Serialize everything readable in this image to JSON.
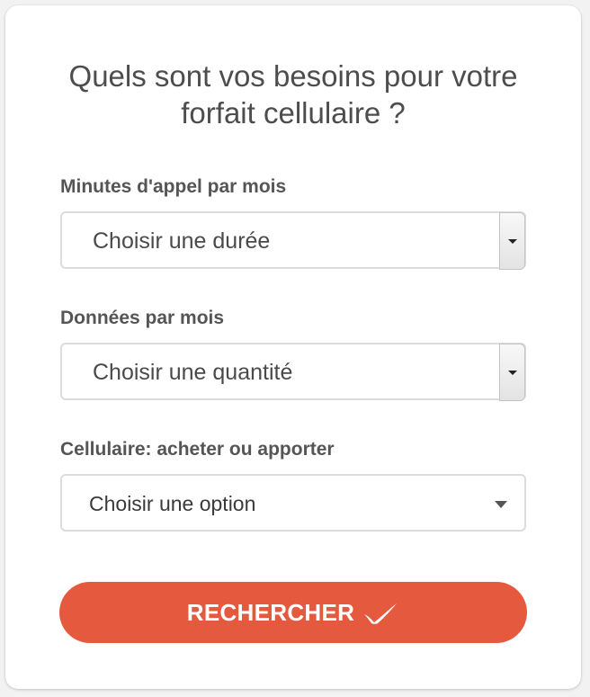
{
  "form": {
    "title_line1": "Quels sont vos besoins pour votre",
    "title_line2": "forfait cellulaire ?",
    "minutes": {
      "label": "Minutes d'appel par mois",
      "selected": "Choisir une durée"
    },
    "data": {
      "label": "Données par mois",
      "selected": "Choisir une quantité"
    },
    "phone": {
      "label": "Cellulaire: acheter ou apporter",
      "selected": "Choisir une option"
    },
    "submit_label": "RECHERCHER"
  },
  "icons": {
    "dropdown_arrow": "triangle-down-icon",
    "submit_icon": "checkmark-swoosh-icon"
  },
  "colors": {
    "accent": "#e55a3f",
    "text": "#4d4d4d",
    "border": "#dcdcdc"
  }
}
